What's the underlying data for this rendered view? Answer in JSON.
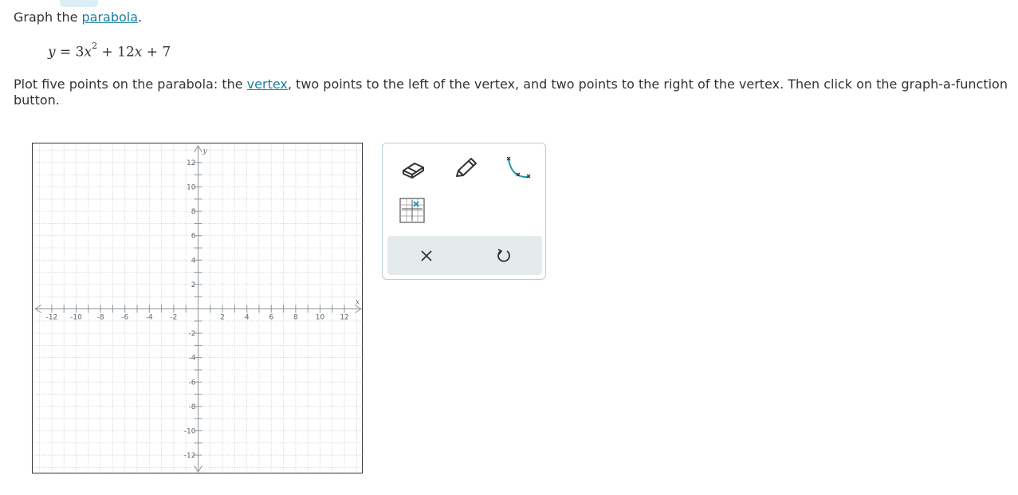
{
  "prompt": {
    "prefix": "Graph the ",
    "link": "parabola",
    "suffix": "."
  },
  "equation": {
    "lhs": "y",
    "eq": " = 3",
    "x1": "x",
    "exp": "2",
    "plus1": " + 12",
    "x2": "x",
    "plus2": " + 7"
  },
  "instructions": {
    "part1": "Plot five points on the parabola: the ",
    "link": "vertex",
    "part2": ", two points to the left of the vertex, and two points to the right of the vertex. Then click on the graph-a-function button."
  },
  "graph": {
    "x_axis_label": "x",
    "y_axis_label": "y",
    "xlim": [
      -13.5,
      13.5
    ],
    "ylim": [
      -13.5,
      13.5
    ],
    "tick_labels": [
      "-12",
      "-10",
      "-8",
      "-6",
      "-4",
      "-2",
      "2",
      "4",
      "6",
      "8",
      "10",
      "12"
    ],
    "colors": {
      "grid": "#cfd6da",
      "axis": "#8c969c",
      "label": "#666666"
    }
  },
  "toolbox": {
    "tools": [
      {
        "name": "eraser-tool",
        "icon": "eraser-icon"
      },
      {
        "name": "pencil-tool",
        "icon": "pencil-icon"
      },
      {
        "name": "parabola-tool",
        "icon": "parabola-curve-icon"
      },
      {
        "name": "graph-a-function-tool",
        "icon": "graph-function-icon"
      }
    ],
    "actions": [
      {
        "name": "clear-button",
        "icon": "close-icon"
      },
      {
        "name": "undo-button",
        "icon": "undo-icon"
      }
    ],
    "accent": "#1b9aaa"
  }
}
